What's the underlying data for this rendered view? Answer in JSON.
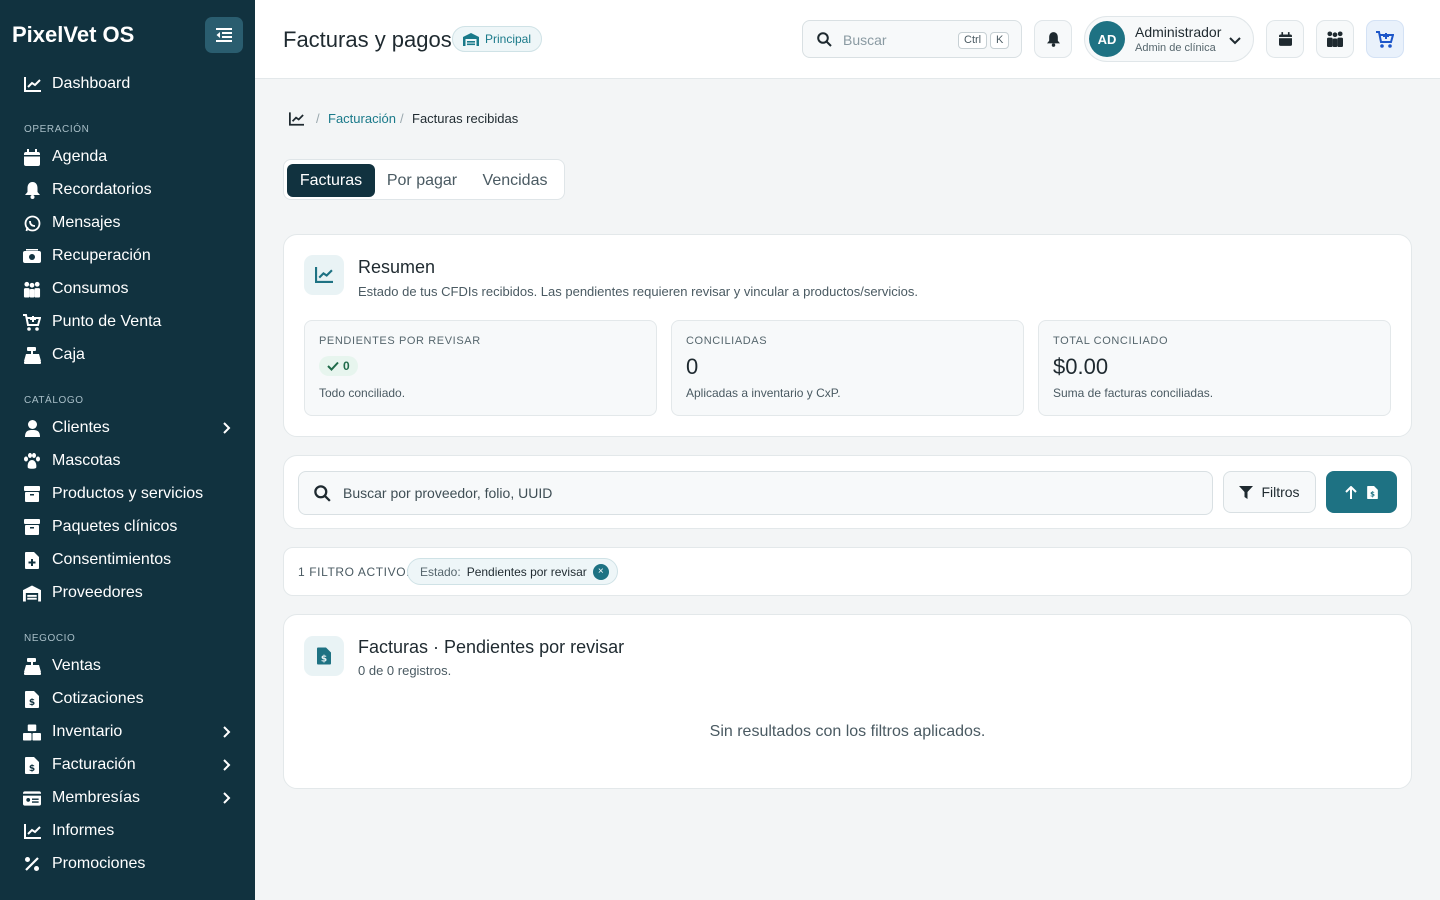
{
  "app": {
    "name": "PixelVet OS"
  },
  "sidebar": {
    "top_item": {
      "label": "Dashboard",
      "icon": "chart-line-icon"
    },
    "sections": [
      {
        "title": "OPERACIÓN",
        "items": [
          {
            "label": "Agenda",
            "icon": "calendar-icon"
          },
          {
            "label": "Recordatorios",
            "icon": "bell-icon"
          },
          {
            "label": "Mensajes",
            "icon": "whatsapp-icon"
          },
          {
            "label": "Recuperación",
            "icon": "money-bill-icon"
          },
          {
            "label": "Consumos",
            "icon": "people-group-icon"
          },
          {
            "label": "Punto de Venta",
            "icon": "cart-icon"
          },
          {
            "label": "Caja",
            "icon": "cash-register-icon"
          }
        ]
      },
      {
        "title": "CATÁLOGO",
        "items": [
          {
            "label": "Clientes",
            "icon": "user-icon",
            "expandable": true
          },
          {
            "label": "Mascotas",
            "icon": "paw-icon"
          },
          {
            "label": "Productos y servicios",
            "icon": "box-icon"
          },
          {
            "label": "Paquetes clínicos",
            "icon": "box-icon"
          },
          {
            "label": "Consentimientos",
            "icon": "file-plus-icon"
          },
          {
            "label": "Proveedores",
            "icon": "warehouse-icon"
          }
        ]
      },
      {
        "title": "NEGOCIO",
        "items": [
          {
            "label": "Ventas",
            "icon": "cash-register-icon"
          },
          {
            "label": "Cotizaciones",
            "icon": "file-invoice-icon"
          },
          {
            "label": "Inventario",
            "icon": "boxes-icon",
            "expandable": true
          },
          {
            "label": "Facturación",
            "icon": "file-invoice-icon",
            "expandable": true
          },
          {
            "label": "Membresías",
            "icon": "id-card-icon",
            "expandable": true
          },
          {
            "label": "Informes",
            "icon": "chart-line-icon"
          },
          {
            "label": "Promociones",
            "icon": "percent-icon"
          }
        ]
      }
    ]
  },
  "header": {
    "title": "Facturas y pagos",
    "branch_badge": "Principal",
    "search_placeholder": "Buscar",
    "kbd_ctrl": "Ctrl",
    "kbd_k": "K",
    "user": {
      "initials": "AD",
      "name": "Administrador",
      "role": "Admin de clínica"
    }
  },
  "breadcrumb": {
    "link": "Facturación",
    "current": "Facturas recibidas",
    "separator": "/"
  },
  "tabs": [
    {
      "label": "Facturas",
      "active": true
    },
    {
      "label": "Por pagar",
      "active": false
    },
    {
      "label": "Vencidas",
      "active": false
    }
  ],
  "summary": {
    "title": "Resumen",
    "subtitle": "Estado de tus CFDIs recibidos. Las pendientes requieren revisar y vincular a productos/servicios.",
    "stats": [
      {
        "label": "PENDIENTES POR REVISAR",
        "value": "0",
        "note": "Todo conciliado."
      },
      {
        "label": "CONCILIADAS",
        "value": "0",
        "note": "Aplicadas a inventario y CxP."
      },
      {
        "label": "TOTAL CONCILIADO",
        "value": "$0.00",
        "note": "Suma de facturas conciliadas."
      }
    ]
  },
  "search": {
    "placeholder": "Buscar por proveedor, folio, UUID",
    "filters_label": "Filtros"
  },
  "active_filters": {
    "label": "1 FILTRO ACTIVO:",
    "chip_key": "Estado:",
    "chip_value": "Pendientes por revisar",
    "chip_close": "×"
  },
  "results": {
    "title": "Facturas · Pendientes por revisar",
    "count_text": "0 de 0 registros.",
    "empty_message": "Sin resultados con los filtros aplicados."
  },
  "colors": {
    "sidebar_bg": "#11323f",
    "accent": "#1e7283",
    "accent_text": "#1a7a8a"
  }
}
